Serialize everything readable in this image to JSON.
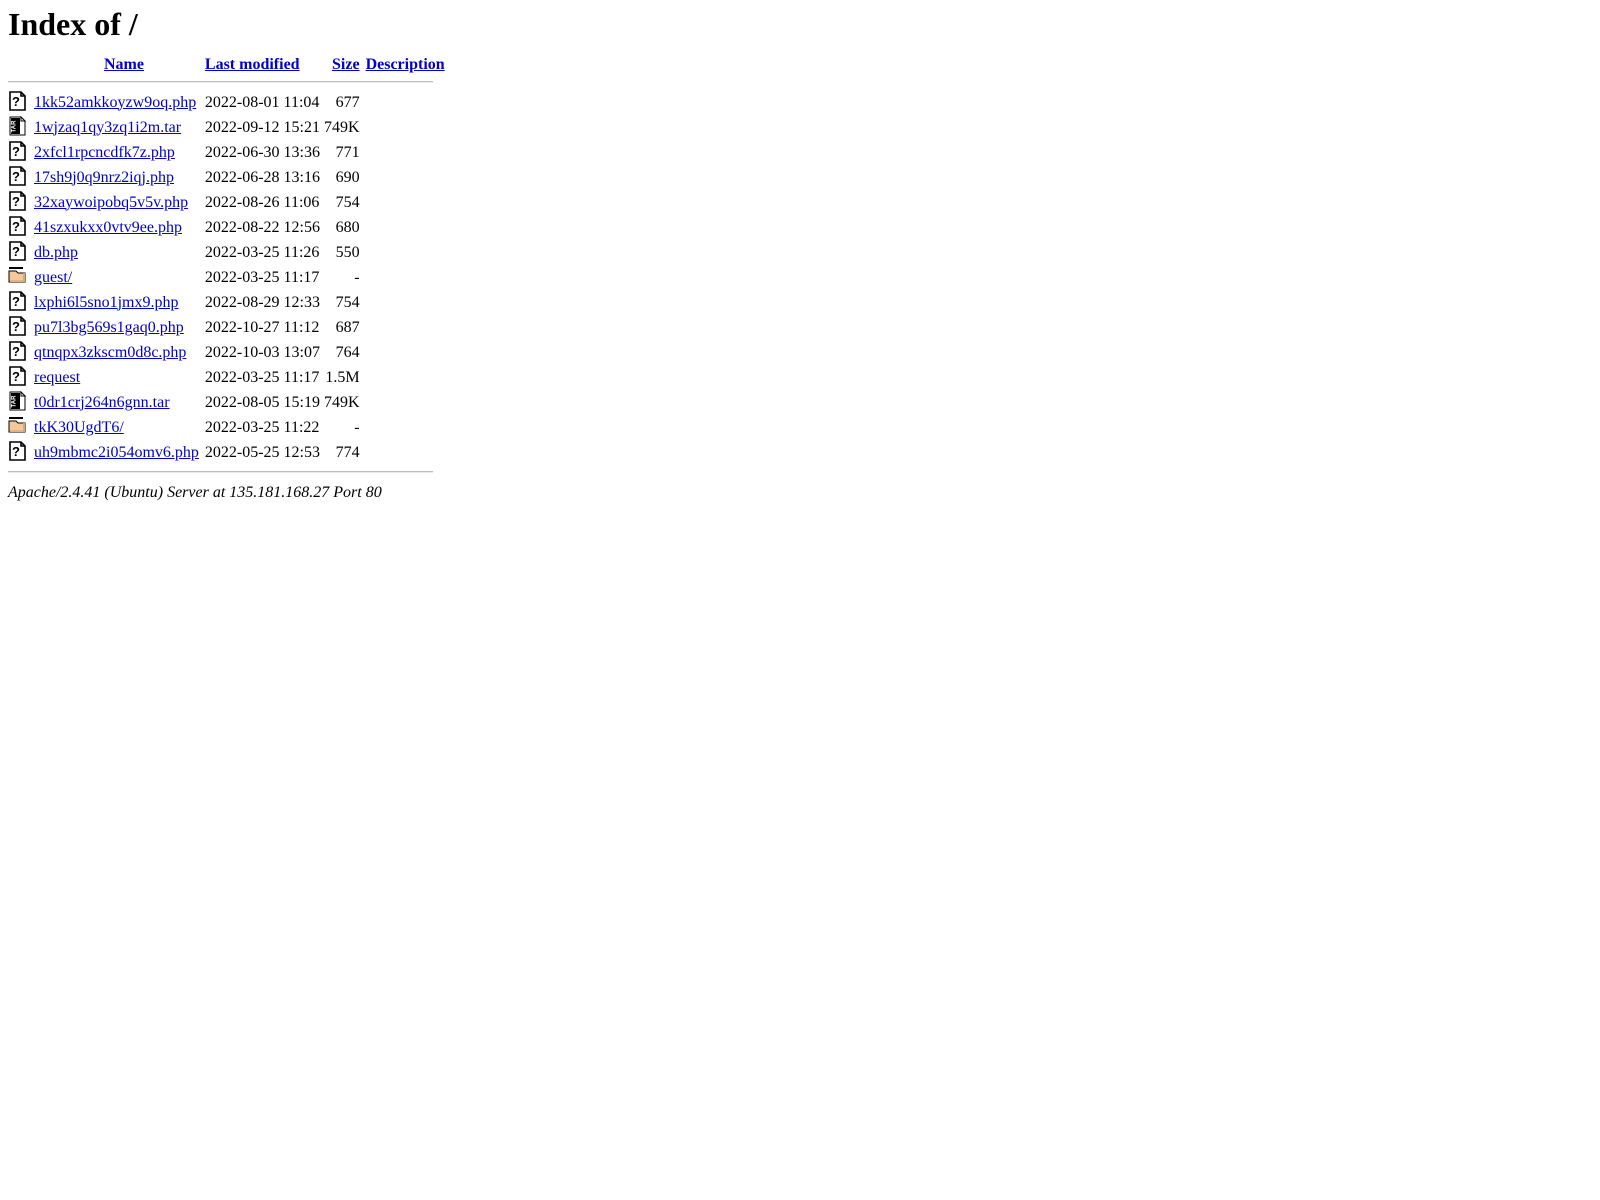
{
  "page": {
    "title": "Index of /",
    "document_title": "Index of /"
  },
  "columns": {
    "name": "Name",
    "last_modified": "Last modified",
    "size": "Size",
    "description": "Description"
  },
  "colors": {
    "link": "#0000cc",
    "header_link": "#0000cc",
    "text": "#000000",
    "background": "#ffffff",
    "rule": "#bfbfbf",
    "folder_icon": "#f5c89a",
    "folder_icon_outline": "#9a6a33"
  },
  "entries": [
    {
      "icon": "unknown-file-icon",
      "name": "1kk52amkkoyzw9oq.php",
      "last_modified": "2022-08-01 11:04",
      "size": "677",
      "description": ""
    },
    {
      "icon": "tar-archive-icon",
      "name": "1wjzaq1qy3zq1i2m.tar",
      "last_modified": "2022-09-12 15:21",
      "size": "749K",
      "description": ""
    },
    {
      "icon": "unknown-file-icon",
      "name": "2xfcl1rpcncdfk7z.php",
      "last_modified": "2022-06-30 13:36",
      "size": "771",
      "description": ""
    },
    {
      "icon": "unknown-file-icon",
      "name": "17sh9j0q9nrz2iqj.php",
      "last_modified": "2022-06-28 13:16",
      "size": "690",
      "description": ""
    },
    {
      "icon": "unknown-file-icon",
      "name": "32xaywoipobq5v5v.php",
      "last_modified": "2022-08-26 11:06",
      "size": "754",
      "description": ""
    },
    {
      "icon": "unknown-file-icon",
      "name": "41szxukxx0vtv9ee.php",
      "last_modified": "2022-08-22 12:56",
      "size": "680",
      "description": ""
    },
    {
      "icon": "unknown-file-icon",
      "name": "db.php",
      "last_modified": "2022-03-25 11:26",
      "size": "550",
      "description": ""
    },
    {
      "icon": "folder-icon",
      "name": "guest/",
      "last_modified": "2022-03-25 11:17",
      "size": "-",
      "description": ""
    },
    {
      "icon": "unknown-file-icon",
      "name": "lxphi6l5sno1jmx9.php",
      "last_modified": "2022-08-29 12:33",
      "size": "754",
      "description": ""
    },
    {
      "icon": "unknown-file-icon",
      "name": "pu7l3bg569s1gaq0.php",
      "last_modified": "2022-10-27 11:12",
      "size": "687",
      "description": ""
    },
    {
      "icon": "unknown-file-icon",
      "name": "qtnqpx3zkscm0d8c.php",
      "last_modified": "2022-10-03 13:07",
      "size": "764",
      "description": ""
    },
    {
      "icon": "unknown-file-icon",
      "name": "request",
      "last_modified": "2022-03-25 11:17",
      "size": "1.5M",
      "description": ""
    },
    {
      "icon": "tar-archive-icon",
      "name": "t0dr1crj264n6gnn.tar",
      "last_modified": "2022-08-05 15:19",
      "size": "749K",
      "description": ""
    },
    {
      "icon": "folder-icon",
      "name": "tkK30UgdT6/",
      "last_modified": "2022-03-25 11:22",
      "size": "-",
      "description": ""
    },
    {
      "icon": "unknown-file-icon",
      "name": "uh9mbmc2i054omv6.php",
      "last_modified": "2022-05-25 12:53",
      "size": "774",
      "description": ""
    }
  ],
  "footer": {
    "server_signature": "Apache/2.4.41 (Ubuntu) Server at 135.181.168.27 Port 80"
  }
}
